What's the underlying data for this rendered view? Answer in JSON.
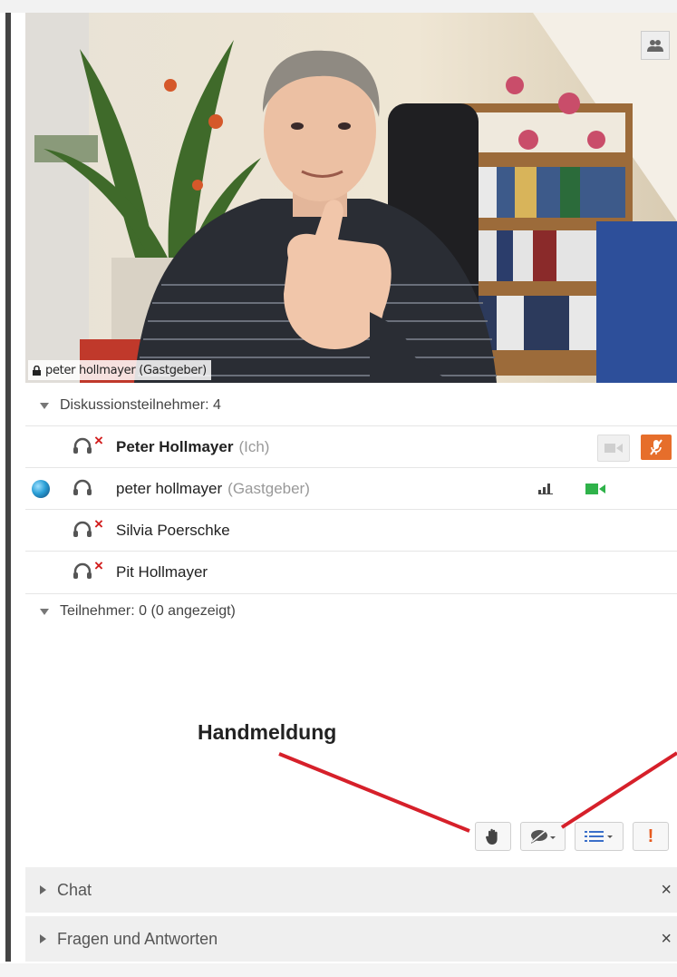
{
  "video": {
    "caption": "peter hollmayer (Gastgeber)"
  },
  "discussion": {
    "header": "Diskussionsteilnehmer: 4",
    "participants": [
      {
        "name": "Peter Hollmayer",
        "role": "(Ich)"
      },
      {
        "name": "peter hollmayer",
        "role": "(Gastgeber)"
      },
      {
        "name": "Silvia Poerschke",
        "role": ""
      },
      {
        "name": "Pit Hollmayer",
        "role": ""
      }
    ]
  },
  "attendees": {
    "header": "Teilnehmer: 0 (0 angezeigt)"
  },
  "annotation": {
    "label": "Handmeldung"
  },
  "panels": {
    "chat": "Chat",
    "qa": "Fragen und Antworten"
  },
  "icons": {
    "muted_mark": "×",
    "close": "×",
    "alert": "!"
  },
  "colors": {
    "mic_button": "#e66e2b",
    "muted_x": "#d21e1e",
    "green_camera": "#2fb24a",
    "arrow": "#d6202a"
  }
}
